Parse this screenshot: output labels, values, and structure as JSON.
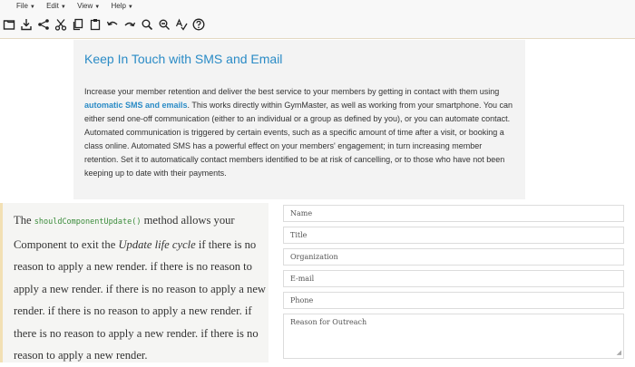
{
  "menu": [
    {
      "label": "File"
    },
    {
      "label": "Edit"
    },
    {
      "label": "View"
    },
    {
      "label": "Help"
    }
  ],
  "toolbar": {
    "icons": [
      "save-icon",
      "download-icon",
      "share-icon",
      "cut-icon",
      "copy-icon",
      "paste-icon",
      "undo-icon",
      "redo-icon",
      "zoom-in-icon",
      "zoom-out-icon",
      "spell-check-icon",
      "help-icon"
    ]
  },
  "article": {
    "title": "Keep In Touch with SMS and Email",
    "p_before": "Increase your member retention and deliver the best service to your members by getting in contact with them using ",
    "link": "automatic SMS and emails",
    "p_after": ". This works directly within GymMaster, as well as working from your smartphone. You can either send one-off communication (either to an individual or a group as defined by you), or you can automate contact. Automated communication is triggered by certain events, such as a specific amount of time after a visit, or booking a class online. Automated SMS has a powerful effect on your members' engagement; in turn increasing member retention. Set it to automatically contact members identified to be at risk of cancelling, or to those who have not been keeping up to date with their payments."
  },
  "doc": {
    "text_before": "The ",
    "code": "shouldComponentUpdate()",
    "text_middle": " method allows your Component to exit the ",
    "emph": "Update life cycle",
    "text_after": " if there is no reason to apply a new render. if there is no reason to apply a new render. if there is no reason to apply a new render. if there is no reason to apply a new render. if there is no reason to apply a new render. if there is no reason to apply a new render."
  },
  "form": {
    "name_placeholder": "Name",
    "title_placeholder": "Title",
    "organization_placeholder": "Organization",
    "email_placeholder": "E-mail",
    "phone_placeholder": "Phone",
    "reason_placeholder": "Reason for Outreach"
  }
}
